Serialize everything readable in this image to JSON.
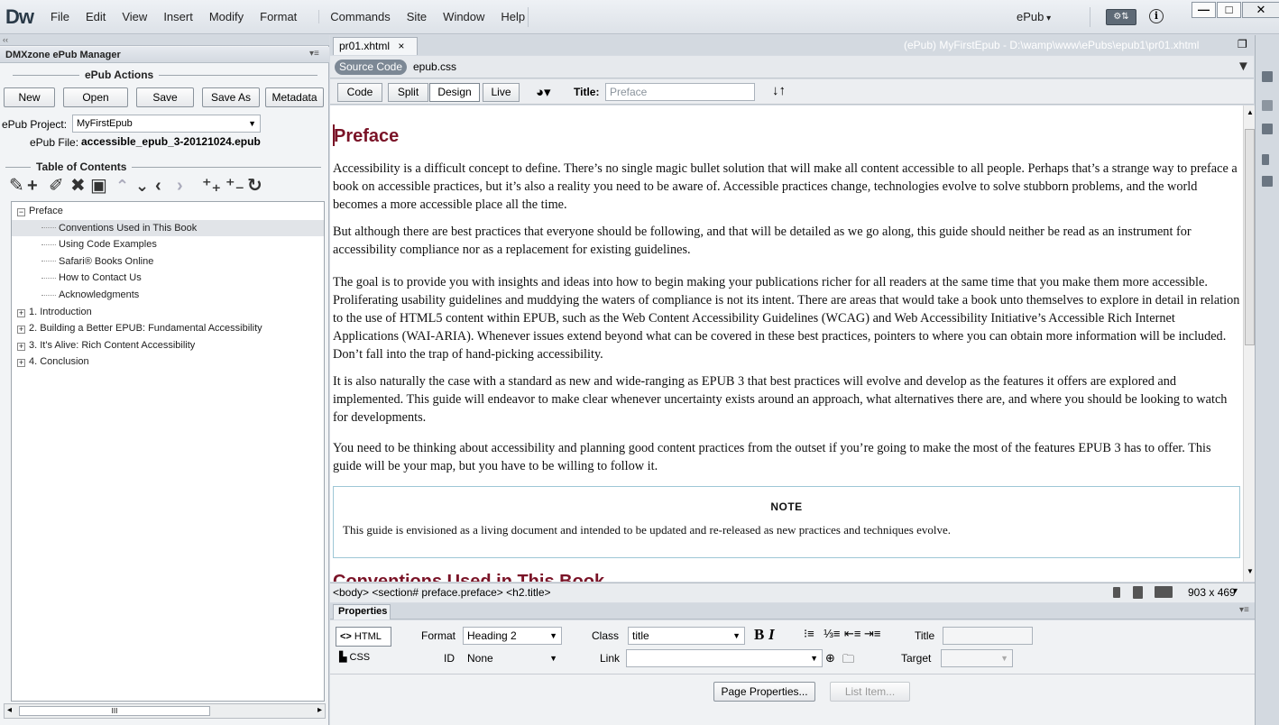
{
  "app": {
    "logo": "Dw",
    "menus": [
      "File",
      "Edit",
      "View",
      "Insert",
      "Modify",
      "Format",
      "Commands",
      "Site",
      "Window",
      "Help"
    ],
    "workspace": "ePub",
    "extension_icon": "⚙⇅",
    "info_icon": "i",
    "window_buttons": {
      "min": "—",
      "max": "□",
      "close": "✕"
    }
  },
  "panel": {
    "collapse": "‹‹",
    "title": "DMXzone ePub Manager",
    "menu": "▾≡",
    "actions_legend": "ePub Actions",
    "buttons": {
      "new": "New",
      "open": "Open",
      "save": "Save",
      "save_as": "Save As",
      "metadata": "Metadata"
    },
    "project_label": "ePub Project:",
    "project_value": "MyFirstEpub",
    "file_label": "ePub File:",
    "file_value": "accessible_epub_3-20121024.epub",
    "toc_legend": "Table of Contents",
    "tree": [
      {
        "label": "Preface",
        "level": 0,
        "exp": "−"
      },
      {
        "label": "Conventions Used in This Book",
        "level": 1
      },
      {
        "label": "Using Code Examples",
        "level": 1
      },
      {
        "label": "Safari® Books Online",
        "level": 1
      },
      {
        "label": "How to Contact Us",
        "level": 1
      },
      {
        "label": "Acknowledgments",
        "level": 1
      },
      {
        "label": "1. Introduction",
        "level": 0,
        "exp": "+"
      },
      {
        "label": "2. Building a Better EPUB: Fundamental Accessibility",
        "level": 0,
        "exp": "+"
      },
      {
        "label": "3. It's Alive: Rich Content Accessibility",
        "level": 0,
        "exp": "+"
      },
      {
        "label": "4. Conclusion",
        "level": 0,
        "exp": "+"
      }
    ],
    "hscroll_grip": "III"
  },
  "doc": {
    "tab": "pr01.xhtml",
    "tab_close": "×",
    "path": "(ePub) MyFirstEpub - D:\\wamp\\www\\ePubs\\epub1\\pr01.xhtml",
    "source_pill": "Source Code",
    "related_file": "epub.css",
    "views": {
      "code": "Code",
      "split": "Split",
      "design": "Design",
      "live": "Live"
    },
    "title_label": "Title:",
    "title_value": "Preface",
    "heading": "Preface",
    "paragraphs": [
      "Accessibility is a difficult concept to define. There’s no single magic bullet solution that will make all content accessible to all people. Perhaps that’s a strange way to preface a book on accessible practices, but it’s also a reality you need to be aware of. Accessible practices change, technologies evolve to solve stubborn problems, and the world becomes a more accessible place all the time.",
      "But although there are best practices that everyone should be following, and that will be detailed as we go along, this guide should neither be read as an instrument for accessibility compliance nor as a replacement for existing guidelines.",
      "The goal is to provide you with insights and ideas into how to begin making your publications richer for all readers at the same time that you make them more accessible. Proliferating usability guidelines and muddying the waters of compliance is not its intent. There are areas that would take a book unto themselves to explore in detail in relation to the use of HTML5 content within EPUB, such as the Web Content Accessibility Guidelines (WCAG) and Web Accessibility Initiative’s Accessible Rich Internet Applications (WAI-ARIA). Whenever issues extend beyond what can be covered in these best practices, pointers to where you can obtain more information will be included. Don’t fall into the trap of hand-picking accessibility.",
      "It is also naturally the case with a standard as new and wide-ranging as EPUB 3 that best practices will evolve and develop as the features it offers are explored and implemented. This guide will endeavor to make clear whenever uncertainty exists around an approach, what alternatives there are, and where you should be looking to watch for developments.",
      "You need to be thinking about accessibility and planning good content practices from the outset if you’re going to make the most of the features EPUB 3 has to offer. This guide will be your map, but you have to be willing to follow it."
    ],
    "note_title": "NOTE",
    "note_body": "This guide is envisioned as a living document and intended to be updated and re-released as new practices and techniques evolve.",
    "next_heading": "Conventions Used in This Book"
  },
  "status": {
    "tagpath": "<body> <section# preface.preface> <h2.title>",
    "dims": "903 x 469"
  },
  "props": {
    "tab": "Properties",
    "html_btn": "HTML",
    "css_btn": "CSS",
    "format_label": "Format",
    "format_value": "Heading 2",
    "class_label": "Class",
    "class_value": "title",
    "id_label": "ID",
    "id_value": "None",
    "link_label": "Link",
    "title_label": "Title",
    "target_label": "Target",
    "page_props": "Page Properties...",
    "list_item": "List Item...",
    "bold": "B",
    "italic": "I"
  },
  "colors": {
    "heading": "#7a1327",
    "pill": "#7c8895",
    "note_border": "#9ec7d6"
  }
}
